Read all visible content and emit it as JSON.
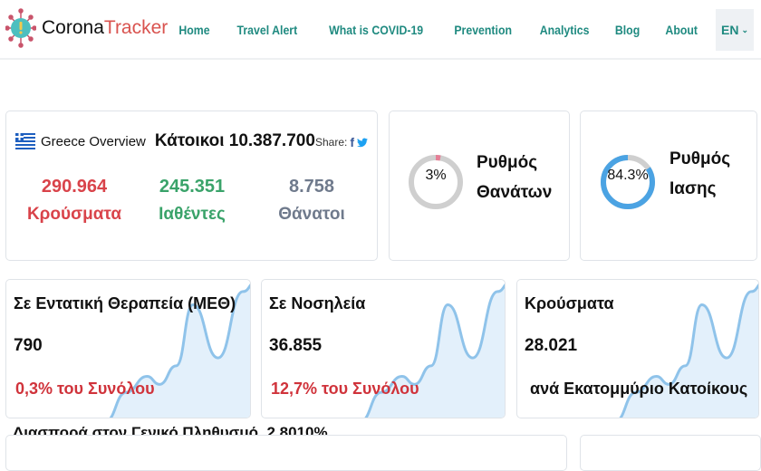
{
  "nav": {
    "brand_part1": "Corona",
    "brand_part2": "Tracker",
    "items": [
      "Home",
      "Travel Alert",
      "What is COVID-19",
      "Prevention",
      "Analytics",
      "Blog",
      "About"
    ],
    "language": "EN"
  },
  "overview": {
    "title": "Greece Overview",
    "population": "Κάτοικοι 10.387.700",
    "share_label": "Share:",
    "stats": [
      {
        "value": "290.964",
        "label": "Κρούσματα",
        "color": "#d9434a"
      },
      {
        "value": "245.351",
        "label": "Ιαθέντες",
        "color": "#3aa36a"
      },
      {
        "value": "8.758",
        "label": "Θάνατοι",
        "color": "#6f7a8c"
      }
    ]
  },
  "death_rate": {
    "value_text": "3%",
    "percent": 3,
    "label_line1": "Ρυθμός",
    "label_line2": "Θανάτων",
    "color": "#e57f96"
  },
  "recovery_rate": {
    "value_text": "84.3%",
    "percent": 84.3,
    "label_line1": "Ρυθμός",
    "label_line2": "Ιασης",
    "color": "#4ba3e3"
  },
  "metric_cards": [
    {
      "title": "Σε Εντατική Θεραπεία (ΜΕΘ)",
      "value": "790",
      "sub": "0,3% του Συνόλου"
    },
    {
      "title": "Σε Νοσηλεία",
      "value": "36.855",
      "sub": "12,7% του Συνόλου"
    },
    {
      "title": "Κρούσματα",
      "value": "28.021",
      "sub": "ανά Εκατομμύριο Κατοίκους"
    }
  ],
  "spread": {
    "label": "Διασπορά στον Γενικό Πληθυσμό",
    "value": "2,8010%"
  }
}
